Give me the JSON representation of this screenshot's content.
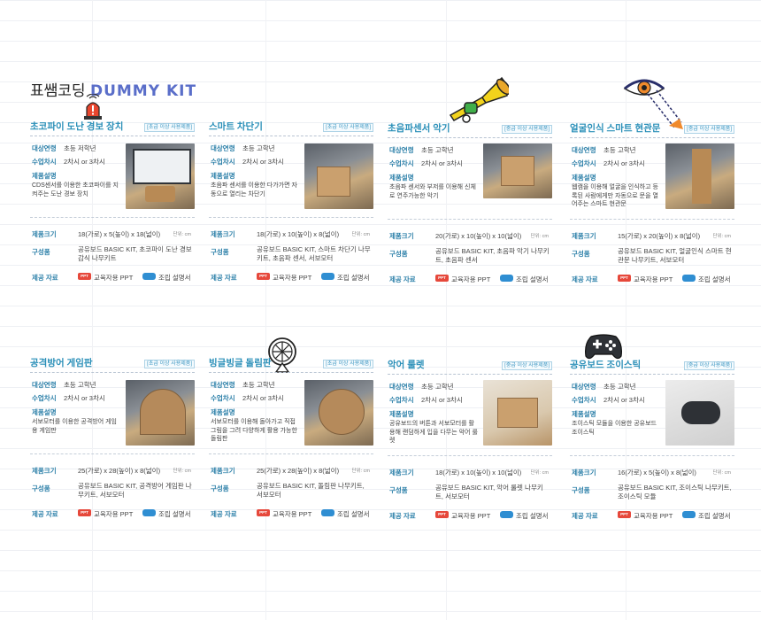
{
  "header": {
    "title_ko": "표쌤코딩",
    "title_kit": "DUMMY KIT"
  },
  "labels": {
    "target": "대상연령",
    "period": "수업차시",
    "desc": "제품설명",
    "size": "제품크기",
    "components": "구성품",
    "materials": "제공 자료",
    "unit": "단위: cm",
    "ppt_icon": "PPT",
    "ppt": "교육자용 PPT",
    "manual": "조립 설명서"
  },
  "cards": [
    {
      "title": "초코파이 도난 경보 장치",
      "badge": "[초급 이상 사용제품]",
      "target": "초등 저학년",
      "period": "2차시 or 3차시",
      "desc": "CDS센서를 이용한 초코파이를 지켜주는 도난 경보 장치",
      "size": "18(가로) x 5(높이) x 18(넓이)",
      "components": "공유보드 BASIC KIT, 초코파이 도난 경보 감식 나무키트",
      "deco": "siren-icon"
    },
    {
      "title": "스마트 차단기",
      "badge": "[초급 이상 사용제품]",
      "target": "초등 고학년",
      "period": "2차시 or 3차시",
      "desc": "초음파 센서를 이용한 다가가면 자동으로 열리는 차단기",
      "size": "18(가로) x 10(높이) x 8(넓이)",
      "components": "공유보드 BASIC KIT, 스마트 차단기 나무키트, 초음파 센서, 서보모터",
      "deco": ""
    },
    {
      "title": "초음파센서 악기",
      "badge": "[중급 이상 사용제품]",
      "target": "초등 고학년",
      "period": "2차시 or 3차시",
      "desc": "초음파 센서와 부저를 이용해 신체로 연주가능한 악기",
      "size": "20(가로) x 10(높이) x 10(넓이)",
      "components": "공유보드 BASIC KIT, 초음파 악기 나무키트, 초음파 센서",
      "deco": "trumpet-icon"
    },
    {
      "title": "얼굴인식 스마트 현관문",
      "badge": "[중급 이상 사용제품]",
      "target": "초등 고학년",
      "period": "2차시 or 3차시",
      "desc": "웹캠을 이용해 얼굴을 인식하고 등록된 사람에게만 자동으로 문을 열어주는 스마트 현관문",
      "size": "15(가로) x 20(높이) x 8(넓이)",
      "components": "공유보드 BASIC KIT, 얼굴인식 스마트 현관문 나무키트, 서보모터",
      "deco": "eye-scan-icon"
    },
    {
      "title": "공격방어 게임판",
      "badge": "[초급 이상 사용제품]",
      "target": "초등 고학년",
      "period": "2차시 or 3차시",
      "desc": "서보모터를 이용한 공격방어 게임용 게임판",
      "size": "25(가로) x 28(높이) x 8(넓이)",
      "components": "공유보드 BASIC KIT, 공격방어 게임판 나무키트, 서보모터",
      "deco": ""
    },
    {
      "title": "빙글빙글 돌림판",
      "badge": "[초급 이상 사용제품]",
      "target": "초등 고학년",
      "period": "2차시 or 3차시",
      "desc": "서보모터를 이용해 돌아가고 직접 그림을 그려 다양하게 활용 가능한 돌림판",
      "size": "25(가로) x 28(높이) x 8(넓이)",
      "components": "공유보드 BASIC KIT, 돌림판 나무키트, 서보모터",
      "deco": "wheel-icon"
    },
    {
      "title": "악어 룰렛",
      "badge": "[중급 이상 사용제품]",
      "target": "초등 고학년",
      "period": "2차시 or 3차시",
      "desc": "공유보드의 버튼과 서보모터를 활용해 랜덤하게 입을 다무는 악어 룰렛",
      "size": "18(가로) x 10(높이) x 10(넓이)",
      "components": "공유보드 BASIC KIT, 악어 룰렛 나무키트, 서보모터",
      "deco": ""
    },
    {
      "title": "공유보드 조이스틱",
      "badge": "[중급 이상 사용제품]",
      "target": "초등 고학년",
      "period": "2차시 or 3차시",
      "desc": "조이스틱 모듈을 이용한 공유보드 조이스틱",
      "size": "16(가로) x 5(높이) x 8(넓이)",
      "components": "공유보드 BASIC KIT, 조이스틱 나무키트, 조이스틱 모듈",
      "deco": "gamepad-icon"
    }
  ],
  "colors": {
    "accent": "#2a8fb8",
    "label": "#2b7fa8",
    "kit": "#5a6ec9",
    "ppt": "#e6483b",
    "manual": "#2f8ed2"
  }
}
